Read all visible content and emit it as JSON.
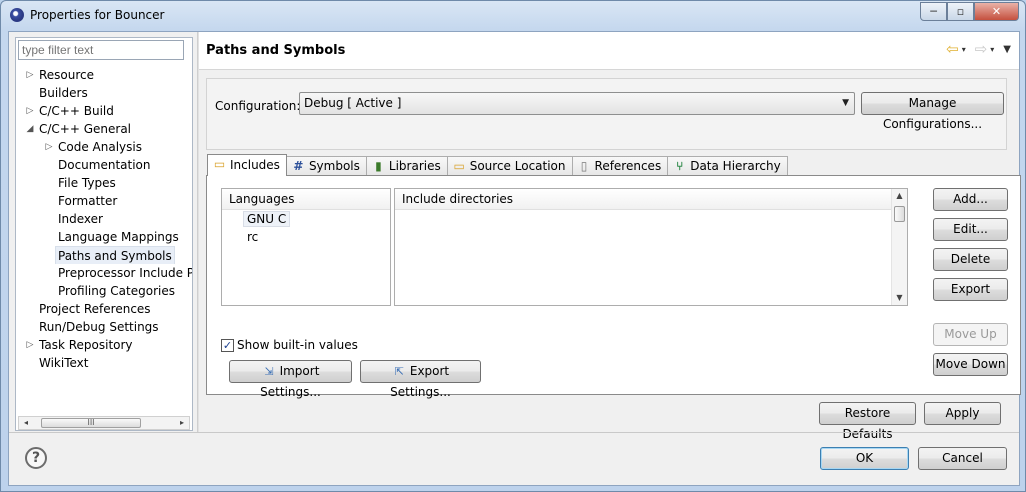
{
  "window": {
    "title": "Properties for Bouncer",
    "minimize": "─",
    "maximize": "▫",
    "close": "✕"
  },
  "filter": {
    "placeholder": "type filter text"
  },
  "tree": [
    {
      "label": "Resource",
      "indent": 0,
      "twisty": "▷"
    },
    {
      "label": "Builders",
      "indent": 0,
      "twisty": ""
    },
    {
      "label": "C/C++ Build",
      "indent": 0,
      "twisty": "▷"
    },
    {
      "label": "C/C++ General",
      "indent": 0,
      "twisty": "◢"
    },
    {
      "label": "Code Analysis",
      "indent": 1,
      "twisty": "▷"
    },
    {
      "label": "Documentation",
      "indent": 1,
      "twisty": ""
    },
    {
      "label": "File Types",
      "indent": 1,
      "twisty": ""
    },
    {
      "label": "Formatter",
      "indent": 1,
      "twisty": ""
    },
    {
      "label": "Indexer",
      "indent": 1,
      "twisty": ""
    },
    {
      "label": "Language Mappings",
      "indent": 1,
      "twisty": ""
    },
    {
      "label": "Paths and Symbols",
      "indent": 1,
      "twisty": "",
      "selected": true
    },
    {
      "label": "Preprocessor Include Pa",
      "indent": 1,
      "twisty": ""
    },
    {
      "label": "Profiling Categories",
      "indent": 1,
      "twisty": ""
    },
    {
      "label": "Project References",
      "indent": 0,
      "twisty": ""
    },
    {
      "label": "Run/Debug Settings",
      "indent": 0,
      "twisty": ""
    },
    {
      "label": "Task Repository",
      "indent": 0,
      "twisty": "▷"
    },
    {
      "label": "WikiText",
      "indent": 0,
      "twisty": ""
    }
  ],
  "hscroll": {
    "left": "◂",
    "right": "▸",
    "grip": "III"
  },
  "page": {
    "title": "Paths and Symbols"
  },
  "nav": {
    "back": "⇦",
    "forward": "⇨",
    "dropdown": "▾",
    "menu": "▼"
  },
  "configuration": {
    "label": "Configuration:",
    "value": "Debug  [ Active ]",
    "manage_button": "Manage Configurations..."
  },
  "tabs": [
    {
      "label": "Includes",
      "icon": "folder-icon",
      "glyph": "▭",
      "color": "#d9a22b",
      "active": true
    },
    {
      "label": "Symbols",
      "icon": "hash-icon",
      "glyph": "#",
      "color": "#2b4f99",
      "active": false
    },
    {
      "label": "Libraries",
      "icon": "books-icon",
      "glyph": "▮",
      "color": "#3b7a2a",
      "active": false
    },
    {
      "label": "Source Location",
      "icon": "source-folder-icon",
      "glyph": "▭",
      "color": "#d9a22b",
      "active": false
    },
    {
      "label": "References",
      "icon": "document-icon",
      "glyph": "▯",
      "color": "#7a7a7a",
      "active": false
    },
    {
      "label": "Data Hierarchy",
      "icon": "hierarchy-icon",
      "glyph": "⑂",
      "color": "#2f8a4a",
      "active": false
    }
  ],
  "languages": {
    "header": "Languages",
    "items": [
      "GNU C",
      "rc"
    ],
    "selected": "GNU C"
  },
  "includes": {
    "header": "Include directories",
    "items": []
  },
  "side_buttons": {
    "add": "Add...",
    "edit": "Edit...",
    "delete": "Delete",
    "export": "Export",
    "move_up": "Move Up",
    "move_down": "Move Down"
  },
  "show_builtin": {
    "label": "Show built-in values",
    "checked": true,
    "mark": "✓"
  },
  "import_settings": "Import Settings...",
  "export_settings": "Export Settings...",
  "restore_defaults": "Restore Defaults",
  "apply": "Apply",
  "ok": "OK",
  "cancel": "Cancel",
  "help": "?"
}
